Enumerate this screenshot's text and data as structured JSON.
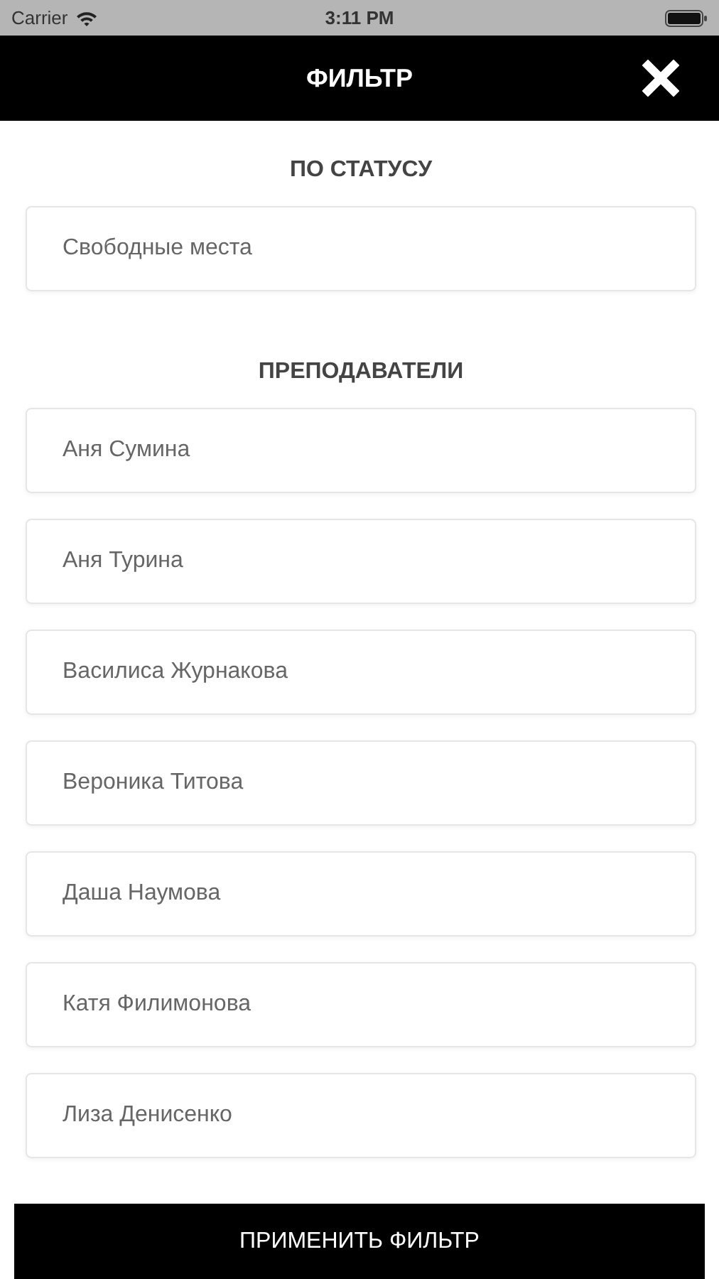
{
  "status_bar": {
    "carrier": "Carrier",
    "time": "3:11 PM"
  },
  "header": {
    "title": "ФИЛЬТР"
  },
  "sections": [
    {
      "title": "ПО СТАТУСУ",
      "items": [
        {
          "label": "Свободные места"
        }
      ]
    },
    {
      "title": "ПРЕПОДАВАТЕЛИ",
      "items": [
        {
          "label": "Аня Сумина"
        },
        {
          "label": "Аня Турина"
        },
        {
          "label": "Василиса Журнакова"
        },
        {
          "label": "Вероника Титова"
        },
        {
          "label": "Даша Наумова"
        },
        {
          "label": "Катя Филимонова"
        },
        {
          "label": "Лиза Денисенко"
        }
      ]
    }
  ],
  "apply_button": {
    "label": "ПРИМЕНИТЬ ФИЛЬТР"
  }
}
